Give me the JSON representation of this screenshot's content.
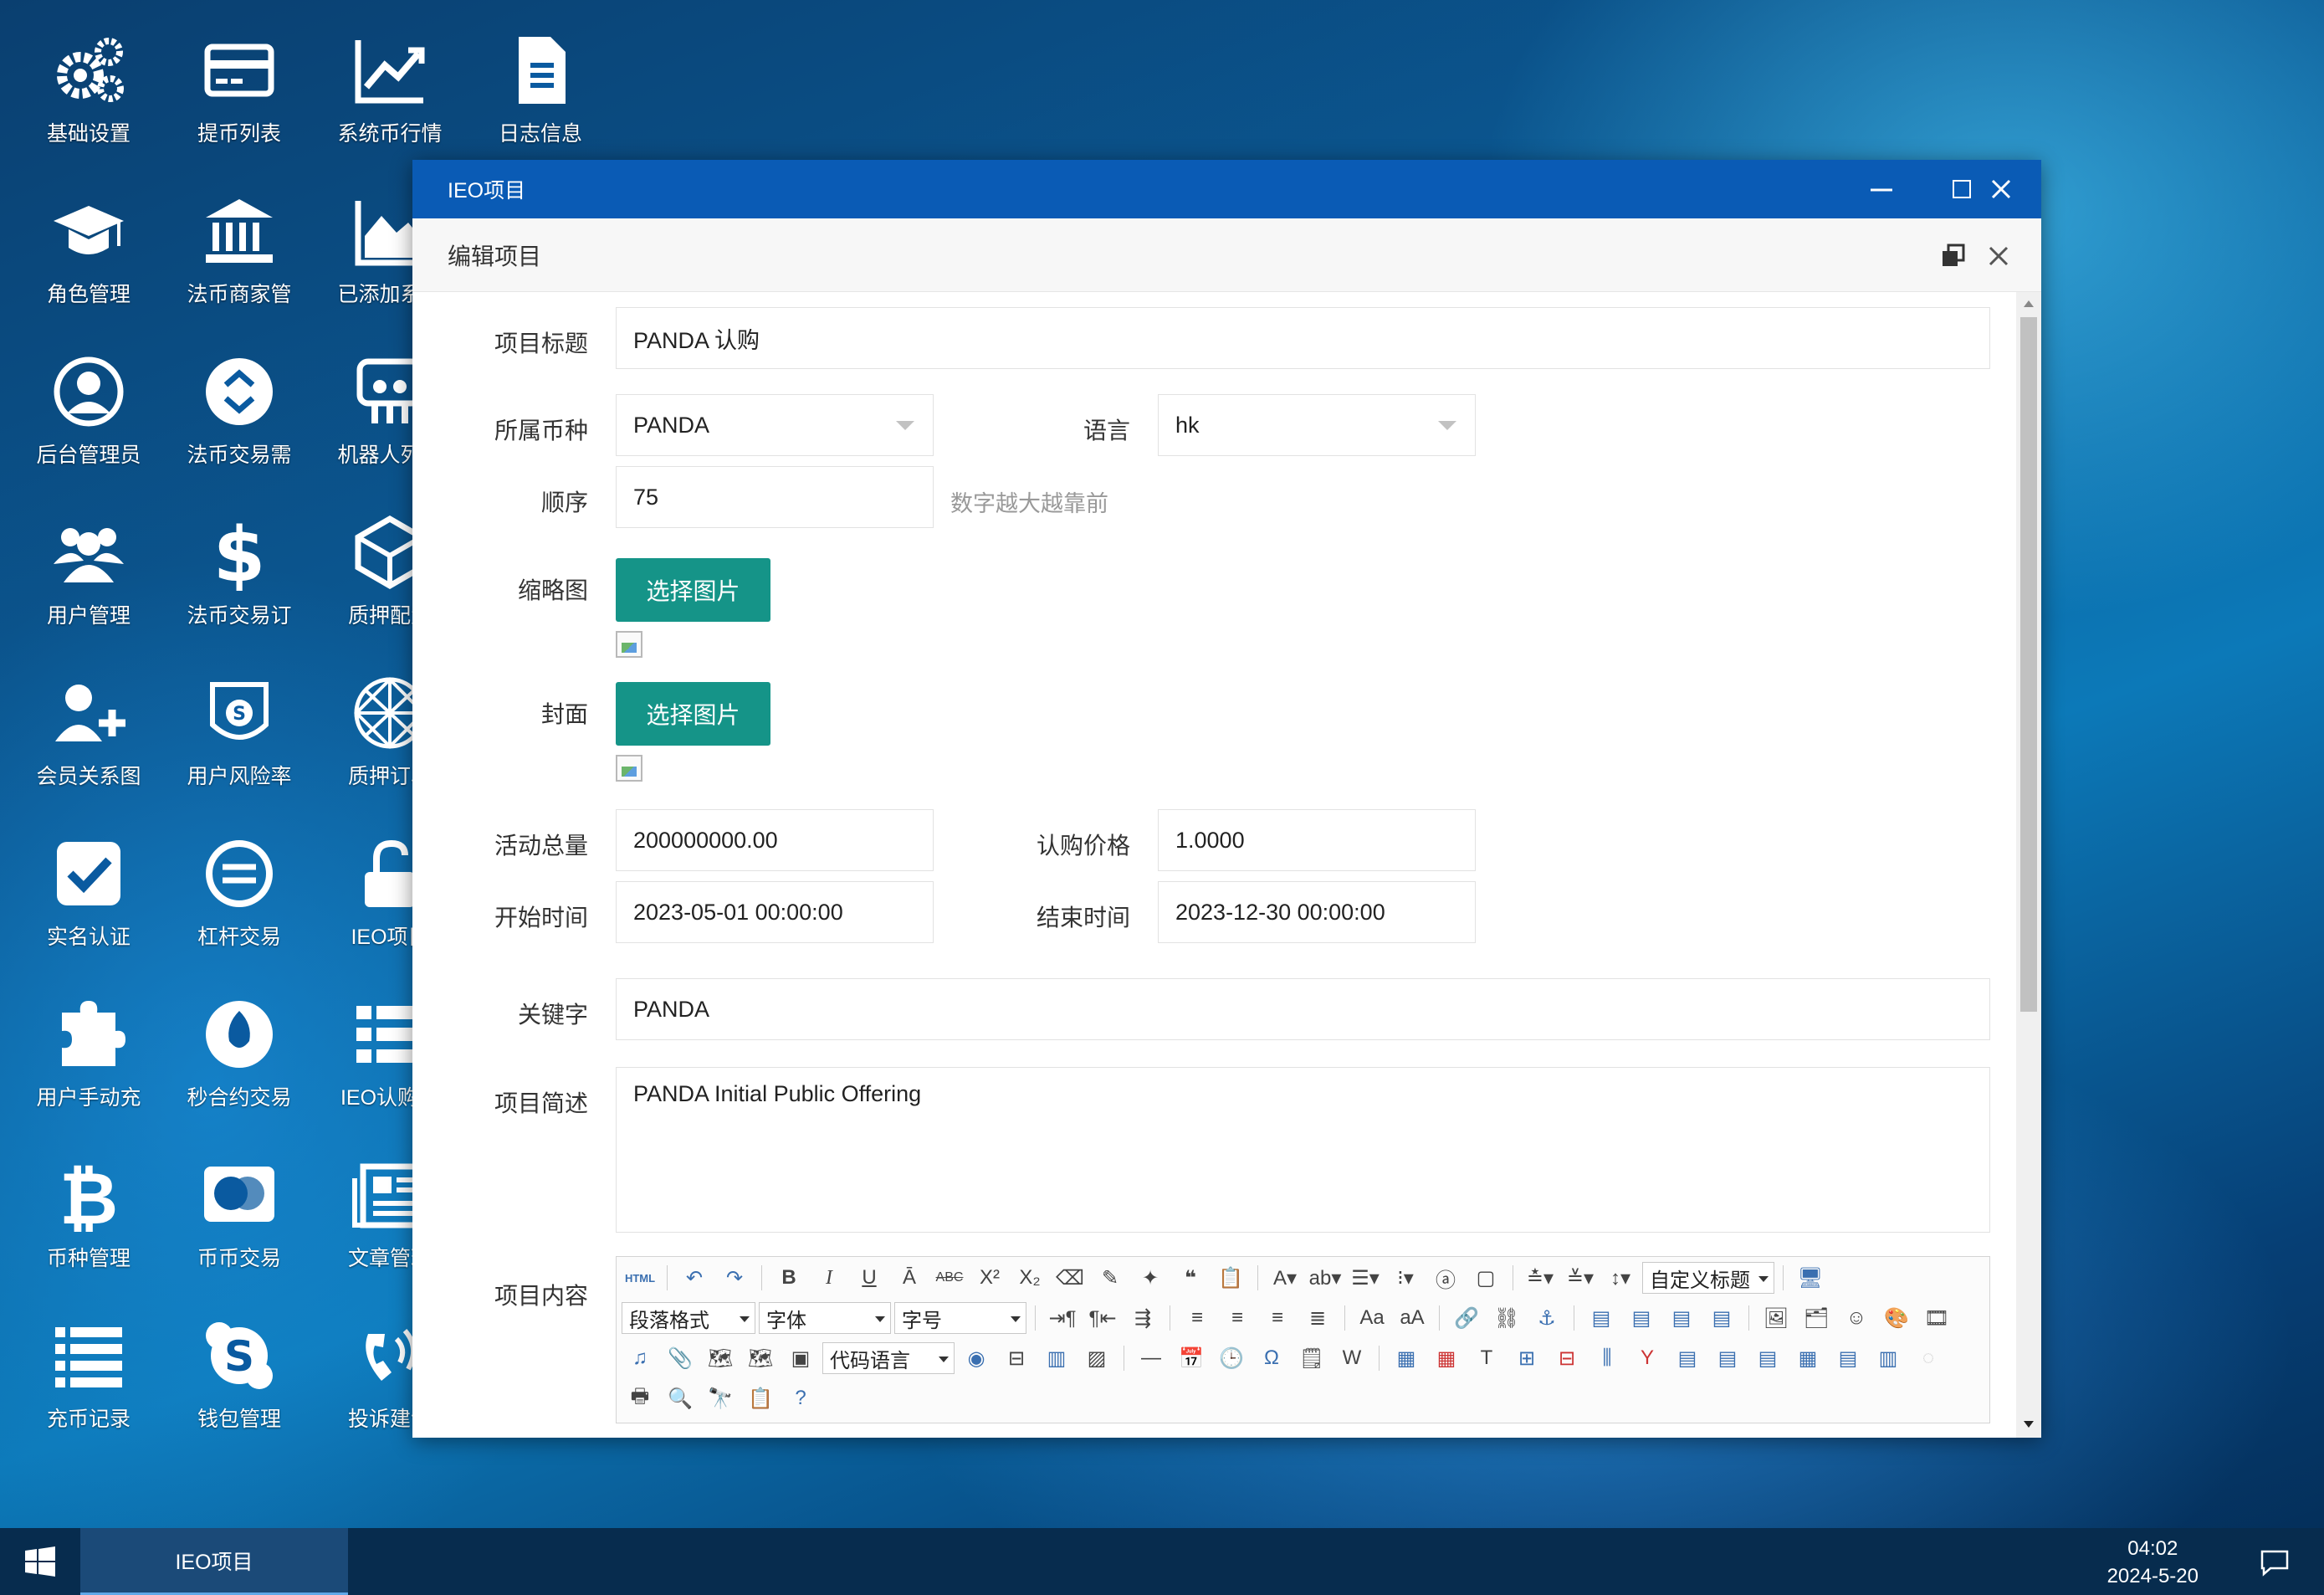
{
  "desktop": {
    "icons": [
      {
        "label": "基础设置",
        "icon": "gears-icon"
      },
      {
        "label": "提币列表",
        "icon": "credit-card-icon"
      },
      {
        "label": "系统币行情",
        "icon": "trend-chart-icon"
      },
      {
        "label": "日志信息",
        "icon": "document-icon"
      },
      {
        "label": "角色管理",
        "icon": "graduation-cap-icon"
      },
      {
        "label": "法币商家管",
        "icon": "bank-icon"
      },
      {
        "label": "已添加系统",
        "icon": "area-chart-icon"
      },
      {
        "label": "后台管理员",
        "icon": "user-circle-icon"
      },
      {
        "label": "法币交易需",
        "icon": "exchange-circle-icon"
      },
      {
        "label": "机器人列表",
        "icon": "robot-icon"
      },
      {
        "label": "用户管理",
        "icon": "users-icon"
      },
      {
        "label": "法币交易订",
        "icon": "dollar-icon"
      },
      {
        "label": "质押配置",
        "icon": "cube-icon"
      },
      {
        "label": "会员关系图",
        "icon": "user-plus-icon"
      },
      {
        "label": "用户风险率",
        "icon": "shield-s-icon"
      },
      {
        "label": "质押订单",
        "icon": "polyhedron-icon"
      },
      {
        "label": "实名认证",
        "icon": "check-square-icon"
      },
      {
        "label": "杠杆交易",
        "icon": "coin-icon"
      },
      {
        "label": "IEO项目",
        "icon": "unlock-icon"
      },
      {
        "label": "用户手动充",
        "icon": "puzzle-icon"
      },
      {
        "label": "秒合约交易",
        "icon": "rebel-icon"
      },
      {
        "label": "IEO认购列",
        "icon": "list-icon"
      },
      {
        "label": "币种管理",
        "icon": "bitcoin-icon"
      },
      {
        "label": "币币交易",
        "icon": "mastercard-icon"
      },
      {
        "label": "文章管理",
        "icon": "newspaper-icon"
      },
      {
        "label": "充币记录",
        "icon": "list-lines-icon"
      },
      {
        "label": "钱包管理",
        "icon": "skype-icon"
      },
      {
        "label": "投诉建议",
        "icon": "phone-volume-icon"
      }
    ]
  },
  "window": {
    "title": "IEO项目",
    "subtitle": "编辑项目"
  },
  "form": {
    "title_label": "项目标题",
    "title_value": "PANDA 认购",
    "currency_label": "所属币种",
    "currency_value": "PANDA",
    "lang_label": "语言",
    "lang_value": "hk",
    "order_label": "顺序",
    "order_value": "75",
    "order_hint": "数字越大越靠前",
    "thumb_label": "缩略图",
    "thumb_button": "选择图片",
    "cover_label": "封面",
    "cover_button": "选择图片",
    "total_label": "活动总量",
    "total_value": "200000000.00",
    "price_label": "认购价格",
    "price_value": "1.0000",
    "start_label": "开始时间",
    "start_value": "2023-05-01 00:00:00",
    "end_label": "结束时间",
    "end_value": "2023-12-30 00:00:00",
    "keyword_label": "关键字",
    "keyword_value": "PANDA",
    "desc_label": "项目简述",
    "desc_value": "PANDA Initial Public Offering",
    "content_label": "项目内容"
  },
  "editor": {
    "html_label": "HTML",
    "custom_title": "自定义标题",
    "paragraph": "段落格式",
    "font": "字体",
    "size": "字号",
    "code_lang": "代码语言"
  },
  "taskbar": {
    "task_label": "IEO项目",
    "time": "04:02",
    "date": "2024-5-20"
  }
}
